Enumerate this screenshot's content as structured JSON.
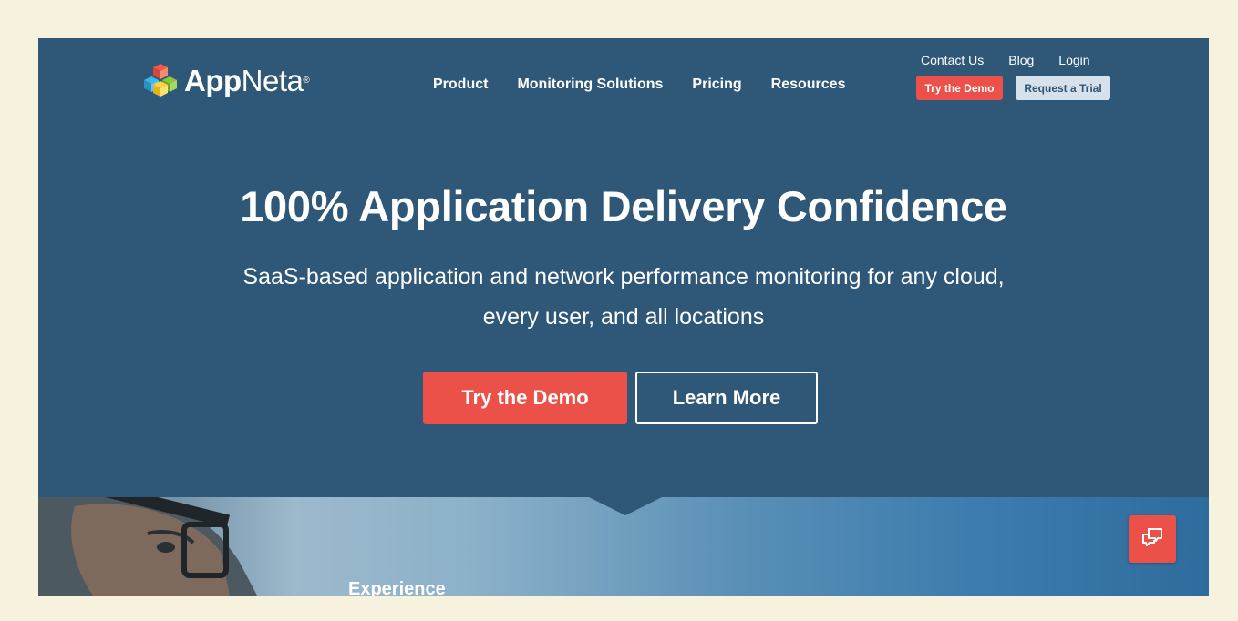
{
  "brand": {
    "name_bold": "App",
    "name_light": "Neta",
    "registered": "®"
  },
  "nav": {
    "main": [
      "Product",
      "Monitoring Solutions",
      "Pricing",
      "Resources"
    ],
    "utility": [
      "Contact Us",
      "Blog",
      "Login"
    ],
    "try_demo": "Try the Demo",
    "request_trial": "Request a Trial"
  },
  "hero": {
    "title": "100% Application Delivery Confidence",
    "subtitle": "SaaS-based application and network performance monitoring for any cloud, every user, and all locations",
    "cta_primary": "Try the Demo",
    "cta_secondary": "Learn More"
  },
  "photo_section": {
    "caption": "Experience"
  },
  "colors": {
    "hero_bg": "#2e5778",
    "accent": "#ec5149",
    "page_bg": "#f6f2dd"
  },
  "icons": {
    "logo": "cube-cluster-icon",
    "chat": "chat-bubbles-icon"
  }
}
